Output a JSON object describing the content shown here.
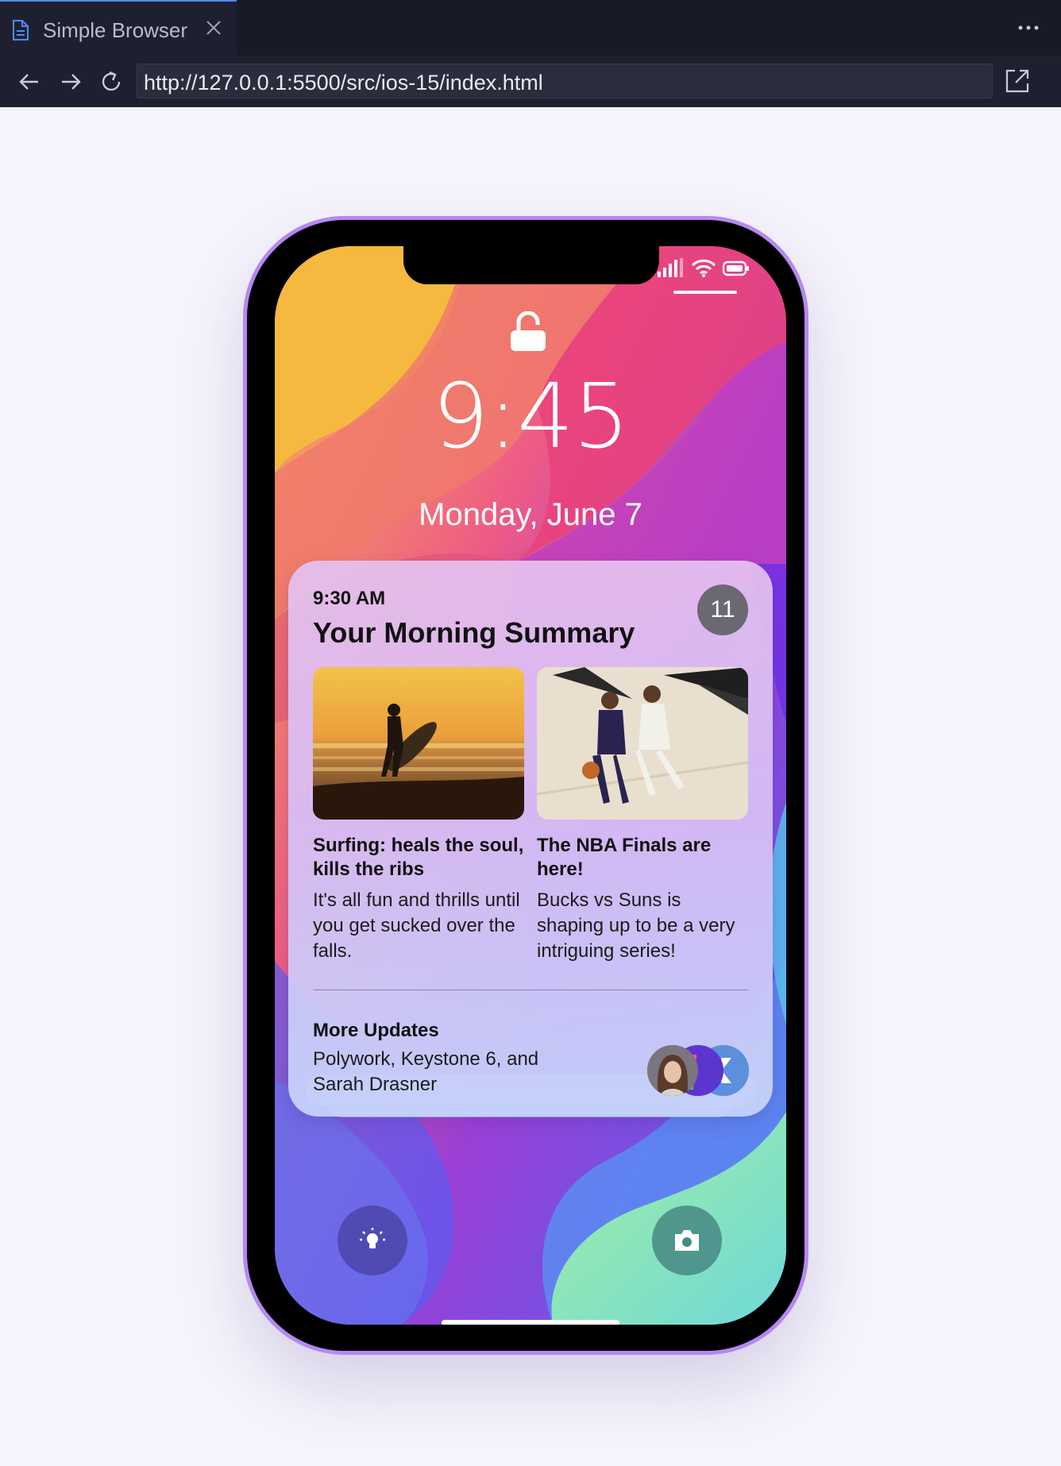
{
  "browser": {
    "tab_title": "Simple Browser",
    "url": "http://127.0.0.1:5500/src/ios-15/index.html",
    "icons": [
      "file-icon",
      "close-icon",
      "more-icon",
      "back-icon",
      "forward-icon",
      "reload-icon",
      "open-external-icon"
    ]
  },
  "lockscreen": {
    "time": "9:45",
    "date": "Monday, June 7",
    "status_icons": [
      "signal-icon",
      "wifi-icon",
      "battery-icon"
    ],
    "lock_icon": "unlocked-padlock-icon"
  },
  "notification": {
    "time": "9:30 AM",
    "title": "Your Morning Summary",
    "count": "11",
    "stories": [
      {
        "headline": "Surfing: heals the soul, kills the ribs",
        "body": "It's all fun and thrills until you get sucked over the falls."
      },
      {
        "headline": "The NBA Finals are here!",
        "body": "Bucks vs Suns is shaping up to be a very intriguing series!"
      }
    ],
    "more": {
      "title": "More Updates",
      "body": "Polywork, Keystone 6, and Sarah Drasner"
    }
  },
  "quick_actions": [
    "flashlight-icon",
    "camera-icon"
  ],
  "colors": {
    "chrome_bg": "#181a25",
    "phone_frame": "#b488f0",
    "badge": "#6b6873"
  }
}
